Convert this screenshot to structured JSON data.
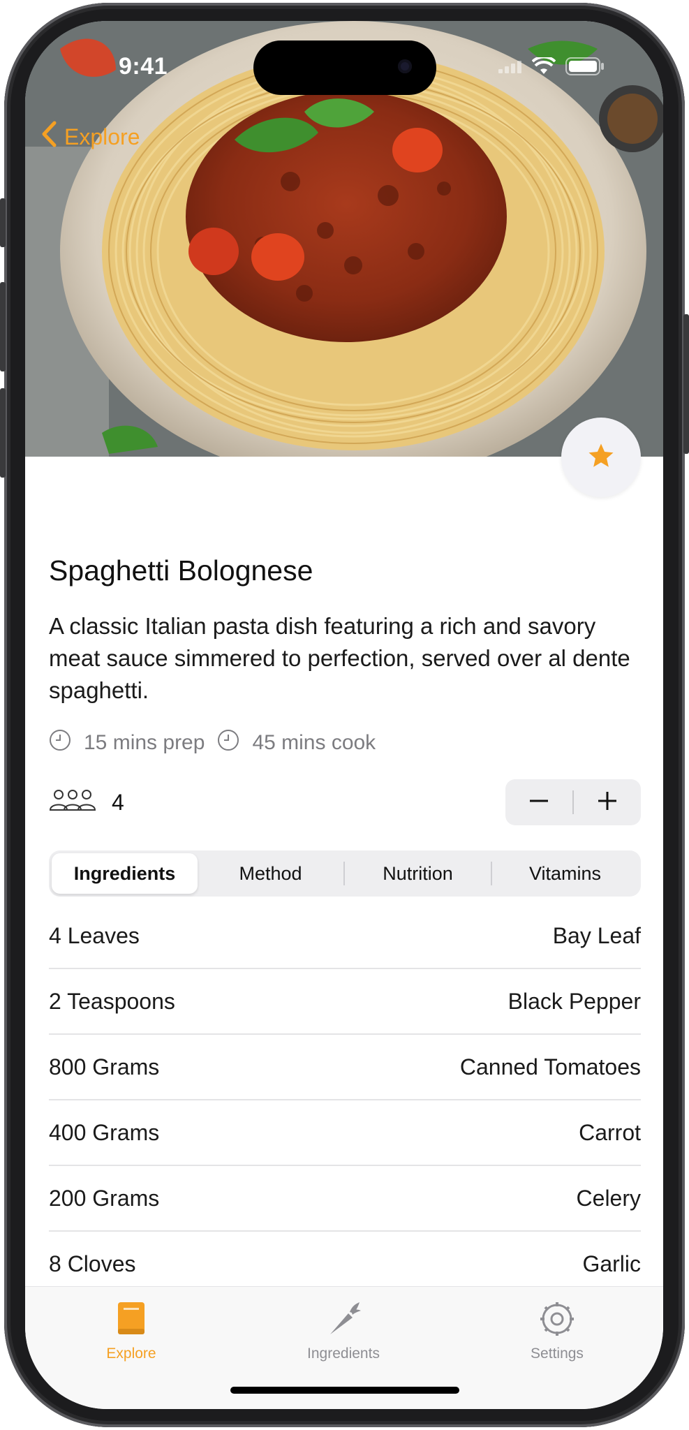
{
  "status": {
    "time": "9:41"
  },
  "nav": {
    "back_label": "Explore"
  },
  "recipe": {
    "title": "Spaghetti Bolognese",
    "description": "A classic Italian pasta dish featuring a rich and savory meat sauce simmered to perfection, served over al dente spaghetti.",
    "prep": "15 mins prep",
    "cook": "45 mins cook",
    "servings": "4"
  },
  "segments": [
    "Ingredients",
    "Method",
    "Nutrition",
    "Vitamins"
  ],
  "selected_segment": "Ingredients",
  "ingredients": [
    {
      "amount": "4 Leaves",
      "name": "Bay Leaf"
    },
    {
      "amount": "2 Teaspoons",
      "name": "Black Pepper"
    },
    {
      "amount": "800 Grams",
      "name": "Canned Tomatoes"
    },
    {
      "amount": "400 Grams",
      "name": "Carrot"
    },
    {
      "amount": "200 Grams",
      "name": "Celery"
    },
    {
      "amount": "8 Cloves",
      "name": "Garlic"
    }
  ],
  "tabbar": {
    "explore": "Explore",
    "ingredients": "Ingredients",
    "settings": "Settings"
  },
  "colors": {
    "accent": "#F5A023",
    "inactive": "#8E8E93"
  }
}
